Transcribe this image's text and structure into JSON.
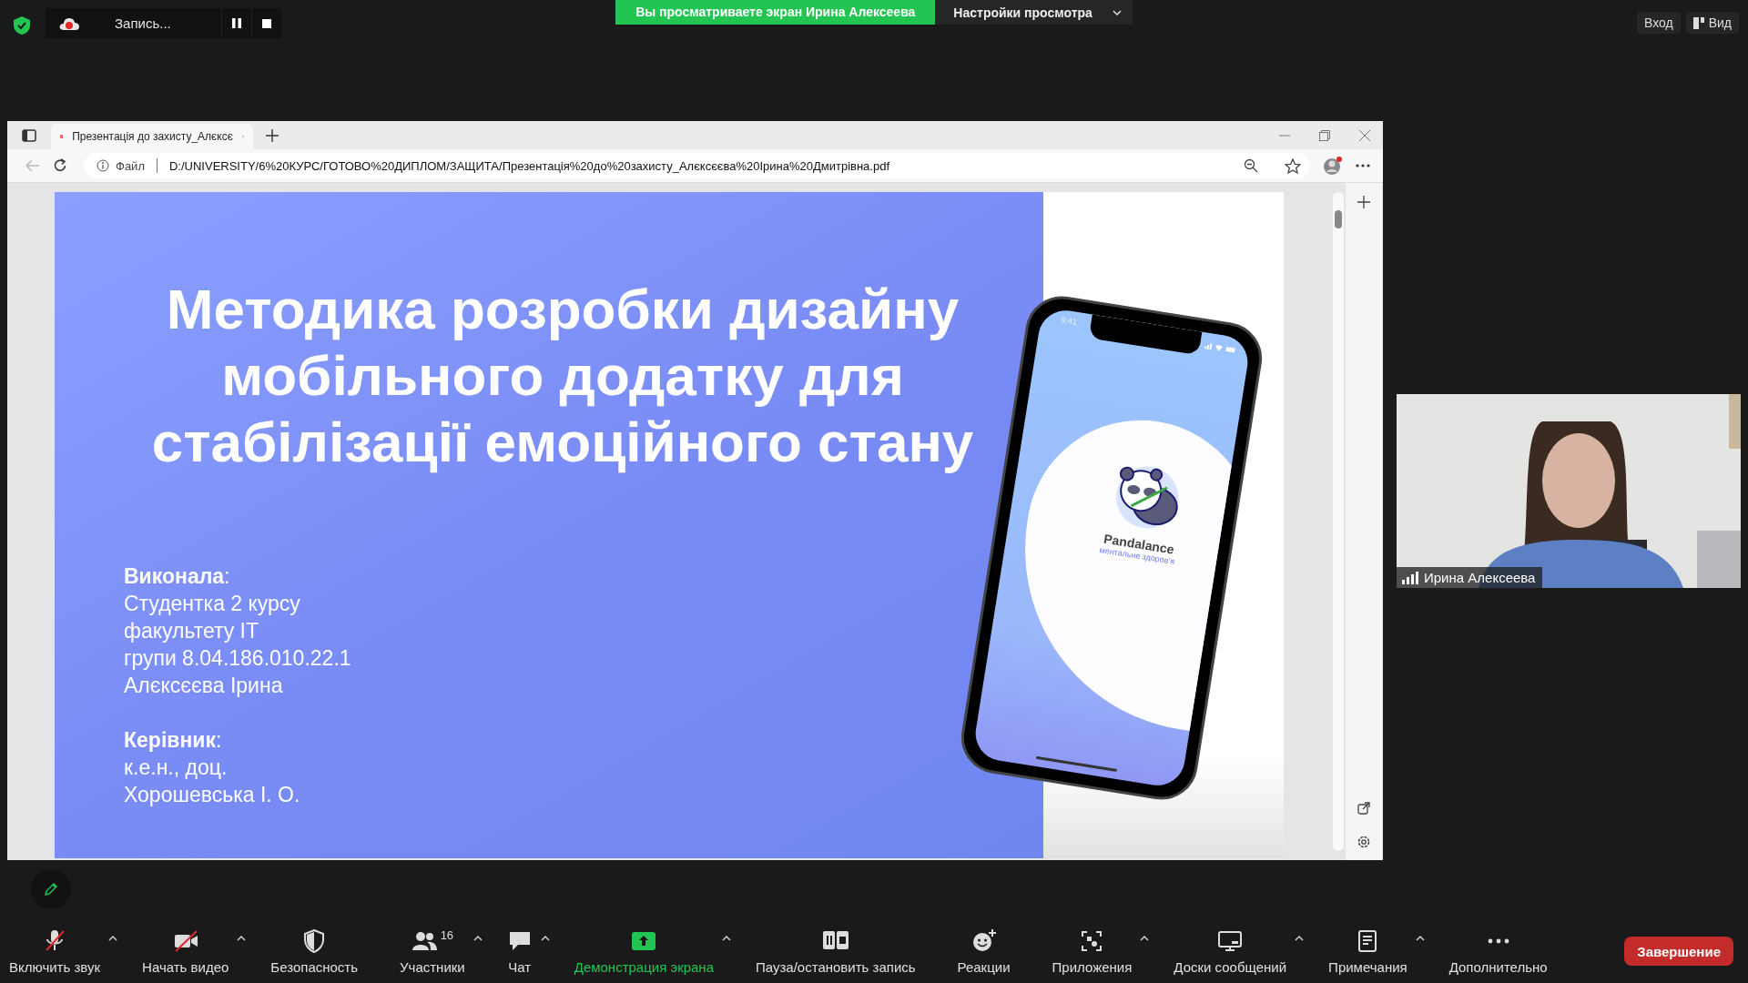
{
  "recording": {
    "label": "Запись..."
  },
  "share_banner": {
    "text": "Вы просматриваете экран Ирина Алексеева",
    "view_options": "Настройки просмотра"
  },
  "top_right": [
    {
      "label": "Вход",
      "kind": "login"
    },
    {
      "label": "Вид",
      "kind": "view"
    }
  ],
  "browser": {
    "tab_title": "Презентація до захисту_Алєксє",
    "address_label": "Файл",
    "url": "D:/UNIVERSITY/6%20КУРС/ГОТОВО%20ДИПЛОМ/ЗАЩИТА/Презентація%20до%20захисту_Алєксєєва%20Ірина%20Дмитрівна.pdf"
  },
  "slide": {
    "title_lines": [
      "Методика розробки дизайну",
      "мобільного додатку для",
      "стабілізації емоційного стану"
    ],
    "blocks": [
      {
        "label": "**Виконала**:",
        "lines": [
          "Студентка 2 курсу",
          "факультету IT",
          "групи 8.04.186.010.22.1",
          "Алєксєєва Ірина"
        ]
      },
      {
        "label": "**Керівник**:",
        "lines": [
          "к.е.н., доц.",
          "Хорошевська І. О."
        ]
      }
    ],
    "phone": {
      "time": "9:41",
      "app_name": "Pandalance",
      "tagline": "ментальне здоров’я"
    }
  },
  "video": {
    "name": "Ирина Алексеева"
  },
  "toolbar": [
    {
      "kind": "mic",
      "label": "Включить звук",
      "off": true,
      "active": false,
      "caret": true
    },
    {
      "kind": "video",
      "label": "Начать видео",
      "off": true,
      "active": false,
      "caret": true
    },
    {
      "kind": "security",
      "label": "Безопасность",
      "active": false,
      "caret": false
    },
    {
      "kind": "participants",
      "label": "Участники",
      "count": "16",
      "active": false,
      "caret": true
    },
    {
      "kind": "chat",
      "label": "Чат",
      "active": false,
      "caret": true
    },
    {
      "kind": "share",
      "label": "Демонстрация экрана",
      "active": true,
      "caret": true
    },
    {
      "kind": "record",
      "label": "Пауза/остановить запись",
      "active": false,
      "caret": false
    },
    {
      "kind": "reactions",
      "label": "Реакции",
      "active": false,
      "caret": false
    },
    {
      "kind": "apps",
      "label": "Приложения",
      "active": false,
      "caret": true
    },
    {
      "kind": "whiteboard",
      "label": "Доски сообщений",
      "active": false,
      "caret": true
    },
    {
      "kind": "notes",
      "label": "Примечания",
      "active": false,
      "caret": true
    },
    {
      "kind": "more",
      "label": "Дополнительно",
      "active": false,
      "caret": false
    }
  ],
  "end_button": "Завершение"
}
